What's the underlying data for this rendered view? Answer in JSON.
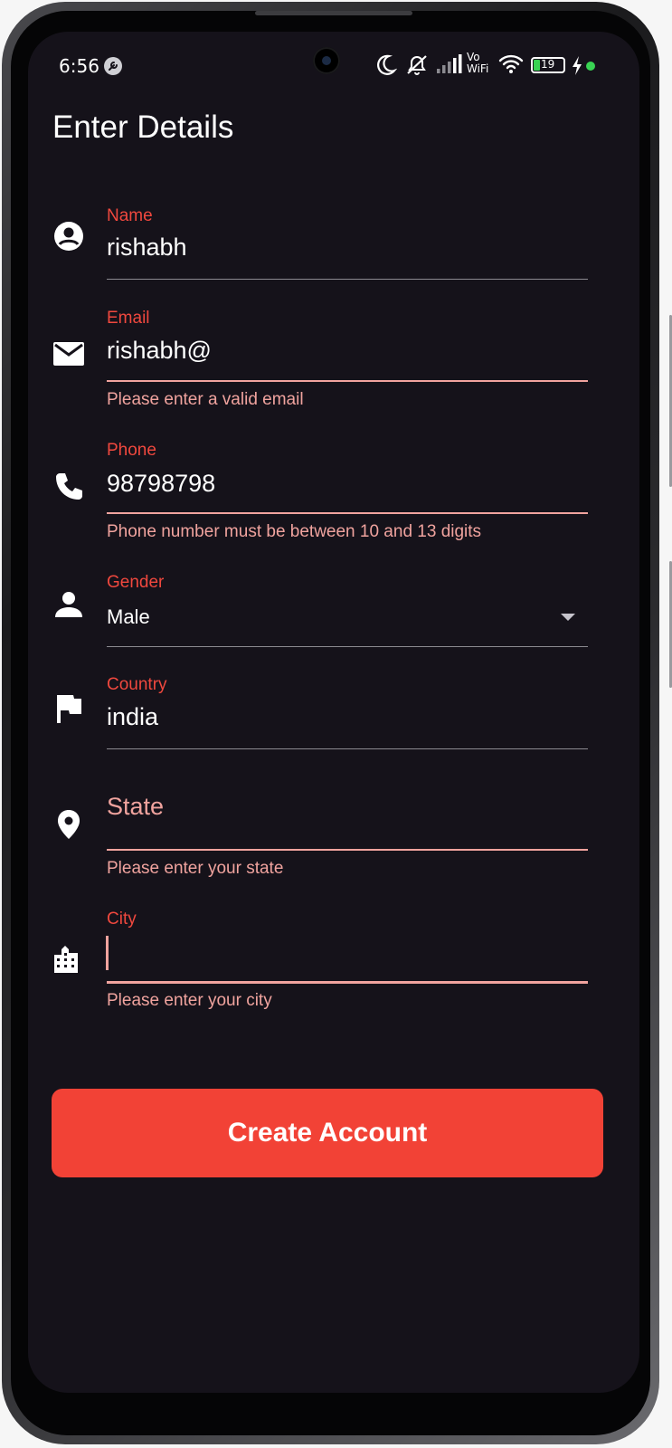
{
  "status_bar": {
    "time": "6:56",
    "battery_level": "19",
    "vowifi_top": "Vo",
    "vowifi_bottom": "WiFi",
    "icons": [
      "wrench-icon",
      "moon-icon",
      "mute-icon",
      "signal-icon",
      "vowifi-icon",
      "wifi-icon",
      "battery-icon",
      "charging-icon"
    ]
  },
  "page": {
    "title": "Enter Details"
  },
  "form": {
    "name": {
      "label": "Name",
      "value": "rishabh"
    },
    "email": {
      "label": "Email",
      "value": "rishabh@",
      "error": "Please enter a valid email"
    },
    "phone": {
      "label": "Phone",
      "value": "98798798",
      "error": "Phone number must be between 10 and 13 digits"
    },
    "gender": {
      "label": "Gender",
      "value": "Male"
    },
    "country": {
      "label": "Country",
      "value": "india"
    },
    "state": {
      "label": "State",
      "value": "",
      "error": "Please enter your state"
    },
    "city": {
      "label": "City",
      "value": "",
      "error": "Please enter your city"
    }
  },
  "actions": {
    "create_account": "Create Account"
  },
  "colors": {
    "background": "#15121a",
    "accent": "#f24236",
    "label": "#f0483e",
    "error": "#f0a39e"
  }
}
